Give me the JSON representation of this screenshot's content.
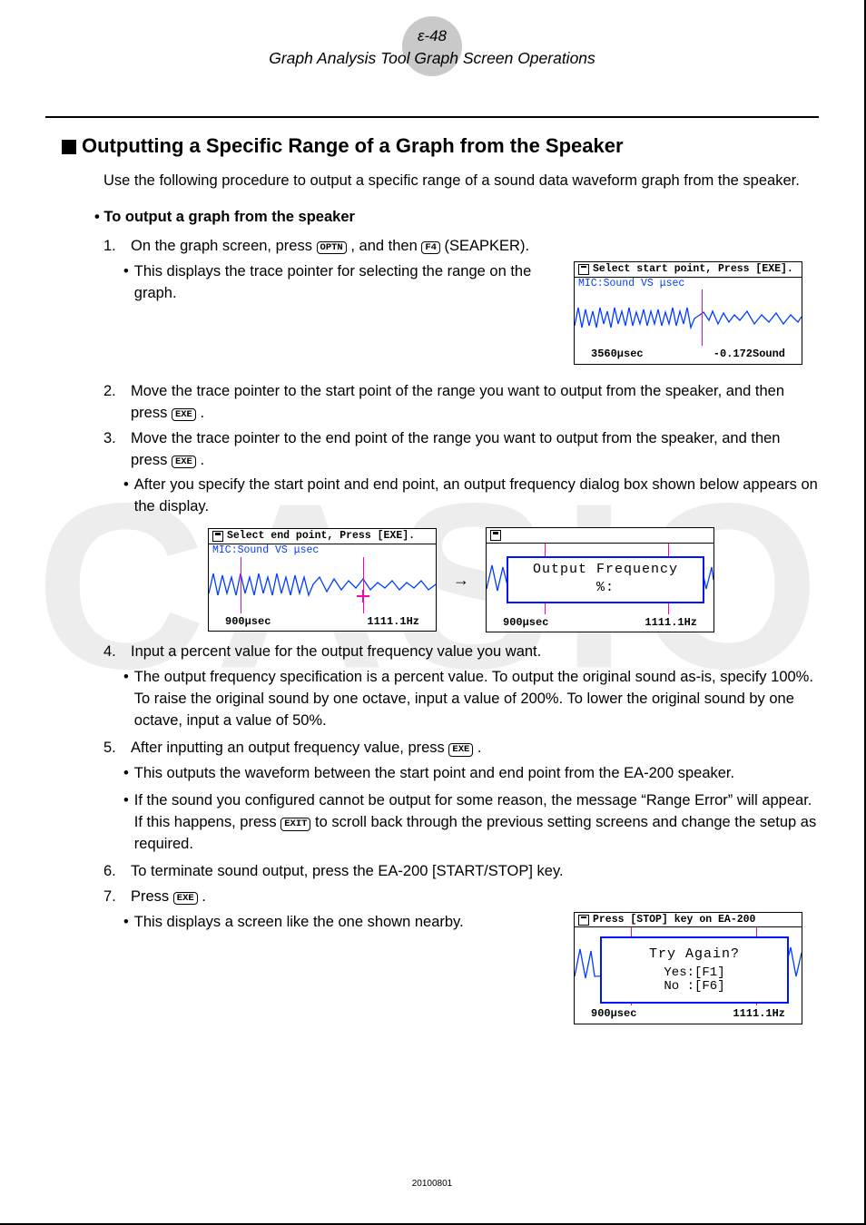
{
  "header": {
    "page_num": "ε-48",
    "title": "Graph Analysis Tool Graph Screen Operations"
  },
  "section": {
    "heading": "Outputting a Specific Range of a Graph from the Speaker",
    "intro": "Use the following procedure to output a specific range of a sound data waveform graph from the speaker."
  },
  "sub": {
    "heading": "To output a graph from the speaker"
  },
  "keys": {
    "optn": "OPTN",
    "f4": "F4",
    "exe": "EXE",
    "exit": "EXIT"
  },
  "step1": {
    "pre": "On the graph screen, press ",
    "mid1": ", and then ",
    "post": "(SEAPKER).",
    "bullet": "This displays the trace pointer for selecting the range on the graph."
  },
  "screen1": {
    "header": "Select start point, Press [EXE].",
    "label": "MIC:Sound VS μsec",
    "x": "3560μsec",
    "y": "-0.172Sound"
  },
  "step2": {
    "text_a": "Move the trace pointer to the start point of the range you want to output from the speaker, and then press ",
    "text_b": "."
  },
  "step3": {
    "text_a": "Move the trace pointer to the end point of the range you want to output from the speaker, and then press ",
    "text_b": ".",
    "bullet": "After you specify the start point and end point, an output frequency dialog box shown below appears on the display."
  },
  "screen2": {
    "header": "Select end point, Press [EXE].",
    "label": "MIC:Sound VS μsec",
    "x": "900μsec",
    "y": "1111.1Hz"
  },
  "screen3": {
    "dlg_title": "Output Frequency",
    "dlg_row": "%:",
    "x": "900μsec",
    "y": "1111.1Hz"
  },
  "arrow": "→",
  "step4": {
    "text": "Input a percent value for the output frequency value you want.",
    "bullet": "The output frequency specification is a percent value. To output the original sound as-is, specify 100%. To raise the original sound by one octave, input a value of 200%. To lower the original sound by one octave, input a value of 50%."
  },
  "step5": {
    "text_a": "After inputting an output frequency value, press ",
    "text_b": ".",
    "bullet_a": "This outputs the waveform between the start point and end point from the EA-200 speaker.",
    "bullet_b_a": "If the sound you configured cannot be output for some reason, the message “Range Error” will appear. If this happens, press ",
    "bullet_b_b": " to scroll back through the previous setting screens and change the setup as required."
  },
  "step6": {
    "text": "To terminate sound output, press the EA-200 [START/STOP] key."
  },
  "step7": {
    "text_a": "Press ",
    "text_b": ".",
    "bullet": "This displays a screen like the one shown nearby."
  },
  "screen4": {
    "header": "Press [STOP] key on EA-200",
    "dlg_title": "Try Again?",
    "dlg_yes": "Yes:[F1]",
    "dlg_no": "No :[F6]",
    "x": "900μsec",
    "y": "1111.1Hz"
  },
  "footer": "20100801",
  "watermark": "CASIO"
}
